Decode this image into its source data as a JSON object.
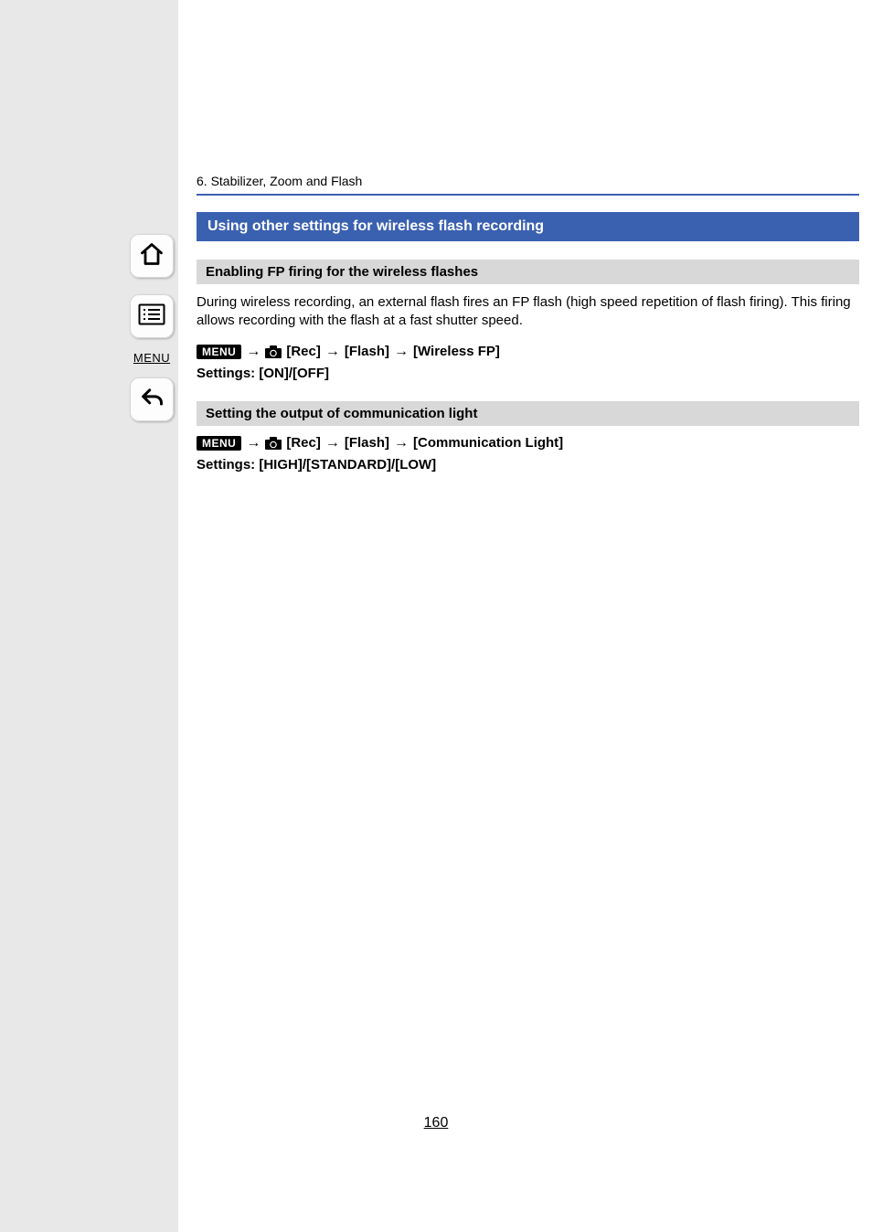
{
  "chapter": "6. Stabilizer, Zoom and Flash",
  "sectionTitle": "Using other settings for wireless flash recording",
  "sub1": {
    "title": "Enabling FP firing for the wireless flashes",
    "body": "During wireless recording, an external flash fires an FP flash (high speed repetition of flash firing). This firing allows recording with the flash at a fast shutter speed.",
    "menuLabel": "MENU",
    "path": [
      "[Rec]",
      "[Flash]",
      "[Wireless FP]"
    ],
    "settings": "Settings: [ON]/[OFF]"
  },
  "sub2": {
    "title": "Setting the output of communication light",
    "menuLabel": "MENU",
    "path": [
      "[Rec]",
      "[Flash]",
      "[Communication Light]"
    ],
    "settings": "Settings: [HIGH]/[STANDARD]/[LOW]"
  },
  "sidebar": {
    "menuText": "MENU"
  },
  "arrow": "→",
  "pageNumber": "160"
}
